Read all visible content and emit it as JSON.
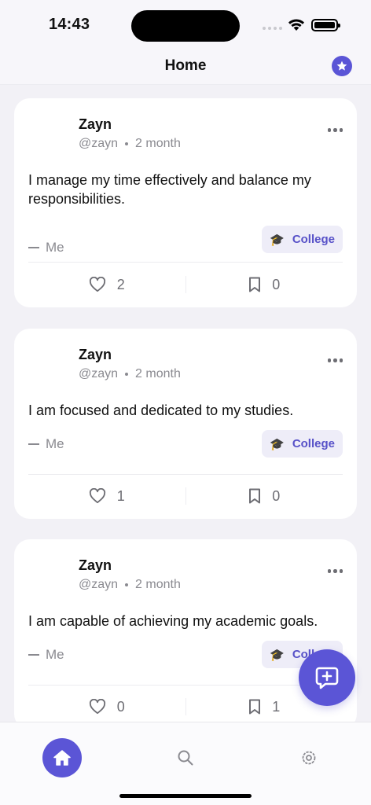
{
  "status_bar": {
    "time": "14:43"
  },
  "header": {
    "title": "Home",
    "action_icon": "star-icon"
  },
  "posts": [
    {
      "author_name": "Zayn",
      "handle": "@zayn",
      "age": "2 month",
      "text": "I manage my time effectively and balance my responsibilities.",
      "attribution": "Me",
      "tag": {
        "emoji": "🎓",
        "label": "College"
      },
      "likes": "2",
      "bookmarks": "0"
    },
    {
      "author_name": "Zayn",
      "handle": "@zayn",
      "age": "2 month",
      "text": "I am focused and dedicated to my studies.",
      "attribution": "Me",
      "tag": {
        "emoji": "🎓",
        "label": "College"
      },
      "likes": "1",
      "bookmarks": "0"
    },
    {
      "author_name": "Zayn",
      "handle": "@zayn",
      "age": "2 month",
      "text": "I am capable of achieving my academic goals.",
      "attribution": "Me",
      "tag": {
        "emoji": "🎓",
        "label": "College"
      },
      "likes": "0",
      "bookmarks": "1"
    }
  ],
  "fab": {
    "icon": "new-post-icon"
  },
  "tabs": [
    {
      "name": "home",
      "icon": "house-icon",
      "active": true
    },
    {
      "name": "search",
      "icon": "search-icon",
      "active": false
    },
    {
      "name": "settings",
      "icon": "settings-icon",
      "active": false
    }
  ],
  "colors": {
    "accent": "#5b55d6",
    "tag_bg": "#eeedf8",
    "background": "#f2f1f6"
  }
}
